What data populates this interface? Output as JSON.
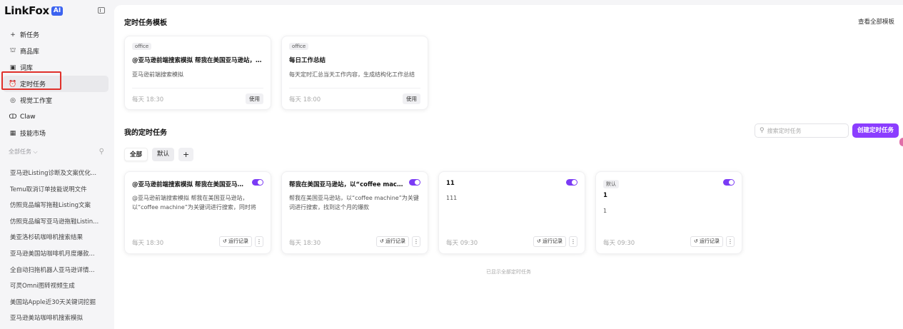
{
  "app": {
    "logo_text": "LinkFox",
    "logo_badge": "AI",
    "brand_color": "#8b3dff",
    "toggle_color": "#7b3bf5",
    "highlight_color": "#e0302a"
  },
  "sidebar": {
    "nav": [
      {
        "icon": "plus-icon",
        "glyph": "+",
        "label": "新任务"
      },
      {
        "icon": "shop-icon",
        "glyph": "⛫",
        "label": "商品库"
      },
      {
        "icon": "book-icon",
        "glyph": "▣",
        "label": "词库"
      },
      {
        "icon": "alarm-clock-icon",
        "glyph": "⏰",
        "label": "定时任务",
        "active": true
      },
      {
        "icon": "palette-icon",
        "glyph": "◎",
        "label": "视觉工作室"
      },
      {
        "icon": "claw-icon",
        "glyph": "ↀ",
        "label": "Claw"
      },
      {
        "icon": "skill-market-icon",
        "glyph": "▦",
        "label": "技能市场"
      }
    ],
    "filter_label": "全部任务 ⌵",
    "history": [
      "亚马逊Listing诊断及文案优化...",
      "Temu取消订单技能说明文件",
      "仿照竞品编写拖鞋Listing文案",
      "仿照竞品编写亚马逊拖鞋Listin...",
      "美亚洛杉矶咖啡机搜索结果",
      "亚马逊美国站咖啡机月度爆款...",
      "全自动扫拖机器人亚马逊详情...",
      "可灵Omni图转视频生成",
      "美国站Apple近30天关键词挖掘",
      "亚马逊美站咖啡机搜索模拟"
    ]
  },
  "templates": {
    "title": "定时任务模板",
    "view_all": "查看全部模板",
    "cards": [
      {
        "tag": "office",
        "title": "@亚马逊前端搜索模拟 帮我在美国亚马逊站，以...",
        "desc": "亚马逊前端搜索模拟",
        "time": "每天 18:30",
        "action": "使用"
      },
      {
        "tag": "office",
        "title": "每日工作总结",
        "desc": "每天定时汇总当天工作内容，生成结构化工作总结",
        "time": "每天 18:00",
        "action": "使用"
      }
    ]
  },
  "my_tasks": {
    "title": "我的定时任务",
    "search_placeholder": "搜索定时任务",
    "create_label": "创建定时任务",
    "tabs": [
      "全部",
      "默认",
      "+"
    ],
    "cards": [
      {
        "title": "@亚马逊前端搜索模拟 帮我在美国亚马逊...",
        "desc": "@亚马逊前端搜索模拟 帮我在美国亚马逊站，以“coffee machine”为关键词进行搜索，同时将配...",
        "time": "每天 18:30",
        "run_label": "运行记录",
        "more": "⋮",
        "enabled": true
      },
      {
        "title": "帮我在美国亚马逊站，以“coffee machin...",
        "desc": "帮我在美国亚马逊站，以“coffee machine”为关键词进行搜索，找到这个月的爆款",
        "time": "每天 18:30",
        "run_label": "运行记录",
        "more": "⋮",
        "enabled": true
      },
      {
        "title": "11",
        "desc": "111",
        "time": "每天 09:30",
        "run_label": "运行记录",
        "more": "⋮",
        "enabled": true
      },
      {
        "tag": "默认",
        "title": "1",
        "desc": "1",
        "time": "每天 09:30",
        "run_label": "运行记录",
        "more": "⋮",
        "enabled": true
      }
    ],
    "footer_note": "已显示全部定时任务"
  }
}
